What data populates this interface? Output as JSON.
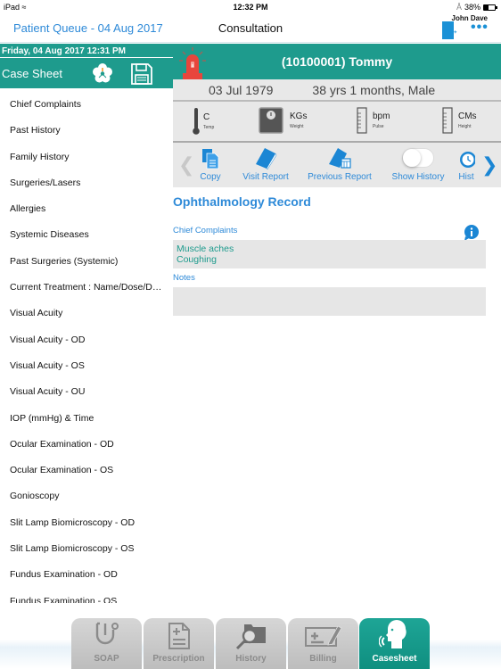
{
  "status_bar": {
    "device": "iPad",
    "time": "12:32 PM",
    "battery_percent": "38%",
    "battery_level": 0.38
  },
  "navbar": {
    "back_label": "Patient Queue - 04 Aug 2017",
    "title": "Consultation",
    "user": "John Dave",
    "more_label": "•••"
  },
  "sidebar": {
    "datetime": "Friday, 04 Aug 2017  12:31 PM",
    "title": "Case Sheet",
    "items": [
      "Chief Complaints",
      "Past History",
      "Family History",
      "Surgeries/Lasers",
      "Allergies",
      "Systemic Diseases",
      "Past Surgeries (Systemic)",
      "Current Treatment : Name/Dose/Duration",
      "Visual Acuity",
      "Visual Acuity - OD",
      "Visual Acuity - OS",
      "Visual Acuity - OU",
      "IOP (mmHg) & Time",
      "Ocular Examination - OD",
      "Ocular Examination - OS",
      "Gonioscopy",
      "Slit Lamp Biomicroscopy - OD",
      "Slit Lamp Biomicroscopy - OS",
      "Fundus Examination - OD",
      "Fundus Examination - OS"
    ]
  },
  "patient": {
    "name": "(10100001) Tommy",
    "alert_badge": "a",
    "dob": "03 Jul 1979",
    "age_gender": "38 yrs 1 months, Male"
  },
  "vitals": [
    {
      "unit": "C",
      "label": "Temp"
    },
    {
      "unit": "KGs",
      "label": "Weight"
    },
    {
      "unit": "bpm",
      "label": "Pulse"
    },
    {
      "unit": "CMs",
      "label": "Height"
    }
  ],
  "toolbar": {
    "copy": "Copy",
    "visit_report": "Visit Report",
    "previous_report": "Previous Report",
    "show_history": "Show History",
    "show_history_on": false,
    "history": "Hist"
  },
  "record": {
    "title": "Ophthalmology Record",
    "chief_complaints_label": "Chief Complaints",
    "chief_complaints": [
      "Muscle aches",
      "Coughing"
    ],
    "notes_label": "Notes",
    "notes": ""
  },
  "tabs": [
    {
      "label": "SOAP",
      "active": false
    },
    {
      "label": "Prescription",
      "active": false
    },
    {
      "label": "History",
      "active": false
    },
    {
      "label": "Billing",
      "active": false
    },
    {
      "label": "Casesheet",
      "active": true
    }
  ],
  "colors": {
    "primary_teal": "#1e9b8d",
    "link_blue": "#2e8ad8",
    "alert_red": "#e8453c"
  }
}
